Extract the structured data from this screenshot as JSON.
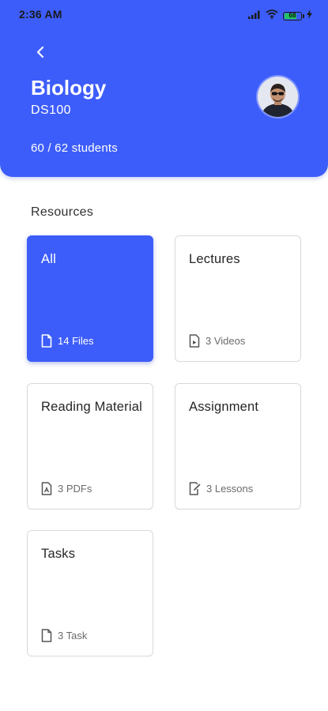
{
  "status_bar": {
    "time": "2:36 AM",
    "battery_level": "68",
    "icons": [
      "signal-icon",
      "wifi-icon",
      "battery-icon",
      "charging-icon"
    ]
  },
  "header": {
    "title": "Biology",
    "code": "DS100",
    "students": "60 / 62 students",
    "accent_color": "#3d5dfa"
  },
  "resources": {
    "heading": "Resources",
    "cards": [
      {
        "label": "All",
        "meta": "14 Files",
        "icon": "file-icon",
        "active": true
      },
      {
        "label": "Lectures",
        "meta": "3 Videos",
        "icon": "video-file-icon",
        "active": false
      },
      {
        "label": "Reading Material",
        "meta": "3 PDFs",
        "icon": "pdf-file-icon",
        "active": false
      },
      {
        "label": "Assignment",
        "meta": "3 Lessons",
        "icon": "assignment-file-icon",
        "active": false
      },
      {
        "label": "Tasks",
        "meta": "3 Task",
        "icon": "task-file-icon",
        "active": false
      }
    ]
  }
}
